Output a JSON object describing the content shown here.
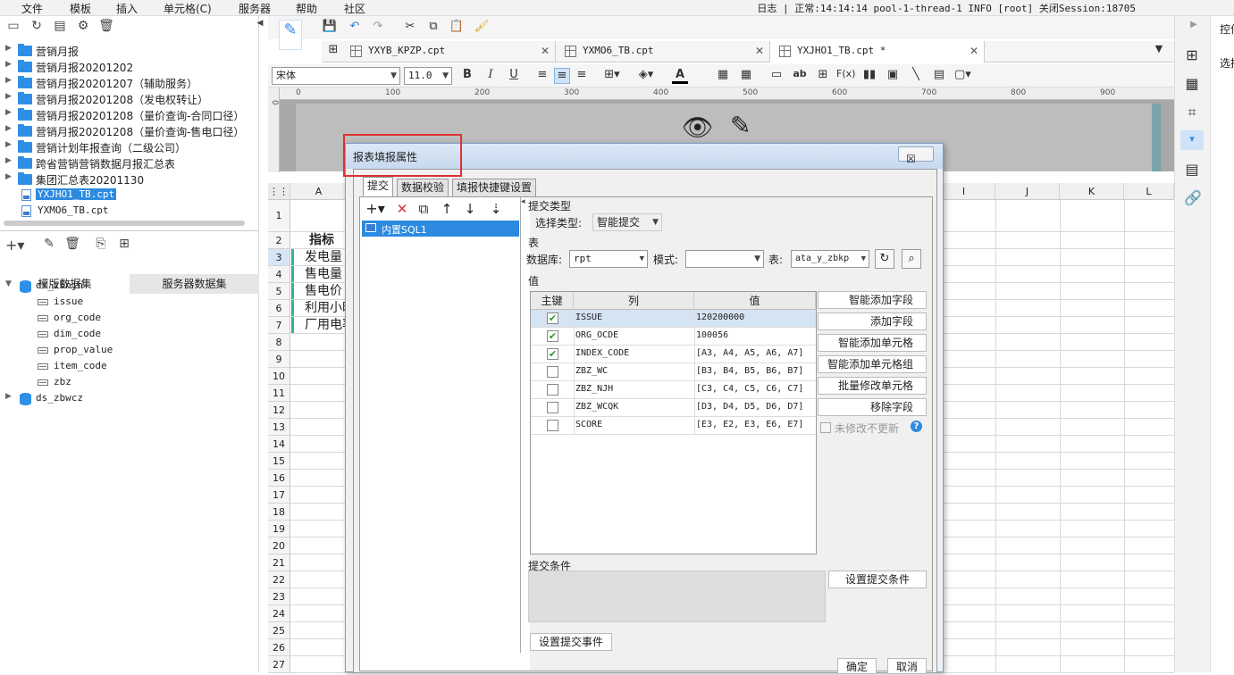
{
  "menubar": {
    "items": [
      "文件",
      "模板",
      "插入",
      "单元格(C)",
      "服务器",
      "帮助",
      "社区"
    ],
    "status": "日志 | 正常:14:14:14 pool-1-thread-1 INFO [root] 关闭Session:18705"
  },
  "tree": {
    "items": [
      {
        "label": "营销月报",
        "type": "folder"
      },
      {
        "label": "营销月报20201202",
        "type": "folder"
      },
      {
        "label": "营销月报20201207（辅助服务）",
        "type": "folder"
      },
      {
        "label": "营销月报20201208（发电权转让）",
        "type": "folder"
      },
      {
        "label": "营销月报20201208（量价查询-合同口径）",
        "type": "folder"
      },
      {
        "label": "营销月报20201208（量价查询-售电口径）",
        "type": "folder"
      },
      {
        "label": "营销计划年报查询（二级公司）",
        "type": "folder"
      },
      {
        "label": "跨省营销营销数据月报汇总表",
        "type": "folder"
      },
      {
        "label": "集团汇总表20201130",
        "type": "folder"
      },
      {
        "label": "YXJHO1_TB.cpt",
        "type": "file",
        "selected": true
      },
      {
        "label": "YXMO6_TB.cpt",
        "type": "file"
      }
    ]
  },
  "datasets": {
    "tabs": [
      "模版数据集",
      "服务器数据集"
    ],
    "ds1": {
      "name": "ds_zbnjh",
      "fields": [
        "issue",
        "org_code",
        "dim_code",
        "prop_value",
        "item_code",
        "zbz"
      ]
    },
    "ds2": {
      "name": "ds_zbwcz"
    }
  },
  "filetabs": [
    {
      "label": "YXYB_KPZP.cpt"
    },
    {
      "label": "YXMO6_TB.cpt"
    },
    {
      "label": "YXJHO1_TB.cpt *"
    }
  ],
  "format": {
    "font": "宋体",
    "size": "11.0"
  },
  "ruler": [
    "0",
    "100",
    "200",
    "300",
    "400",
    "500",
    "600",
    "700",
    "800",
    "900"
  ],
  "grid": {
    "columns_left": [
      "A"
    ],
    "columns_right": [
      "I",
      "J",
      "K",
      "L"
    ],
    "rows": [
      "1",
      "2",
      "3",
      "4",
      "5",
      "6",
      "7",
      "8",
      "9",
      "10",
      "11",
      "12",
      "13",
      "14",
      "15",
      "16",
      "17",
      "18",
      "19",
      "20",
      "21",
      "22",
      "23",
      "24",
      "25",
      "26",
      "27"
    ],
    "cellsA": [
      "",
      "指标",
      "发电量",
      "售电量",
      "售电价",
      "利用小时",
      "厂用电率"
    ]
  },
  "rightpanel": {
    "title": "控件",
    "sub": "选择"
  },
  "dialog": {
    "title": "报表填报属性",
    "close": "☒",
    "tabs": [
      "提交",
      "数据校验",
      "填报快捷键设置"
    ],
    "list_item": "内置SQL1",
    "section_type": "提交类型",
    "select_type_label": "选择类型:",
    "select_type_value": "智能提交",
    "section_table": "表",
    "db_label": "数据库:",
    "db_value": "rpt",
    "mode_label": "模式:",
    "mode_value": "",
    "table_label": "表:",
    "table_value": "ata_y_zbkp",
    "section_value": "值",
    "value_headers": [
      "主键",
      "列",
      "值"
    ],
    "value_rows": [
      {
        "key": true,
        "col": "ISSUE",
        "val": "120200000"
      },
      {
        "key": true,
        "col": "ORG_OCDE",
        "val": "100056"
      },
      {
        "key": true,
        "col": "INDEX_CODE",
        "val": "[A3, A4, A5, A6, A7]"
      },
      {
        "key": false,
        "col": "ZBZ_WC",
        "val": "[B3, B4, B5, B6, B7]"
      },
      {
        "key": false,
        "col": "ZBZ_NJH",
        "val": "[C3, C4, C5, C6, C7]"
      },
      {
        "key": false,
        "col": "ZBZ_WCQK",
        "val": "[D3, D4, D5, D6, D7]"
      },
      {
        "key": false,
        "col": "SCORE",
        "val": "[E3, E2, E3, E6, E7]"
      }
    ],
    "side_buttons": [
      "智能添加字段",
      "添加字段",
      "智能添加单元格",
      "智能添加单元格组",
      "批量修改单元格",
      "移除字段"
    ],
    "unmodified_label": "未修改不更新",
    "section_condition": "提交条件",
    "set_condition": "设置提交条件",
    "set_event": "设置提交事件",
    "ok": "确定",
    "cancel": "取消"
  }
}
